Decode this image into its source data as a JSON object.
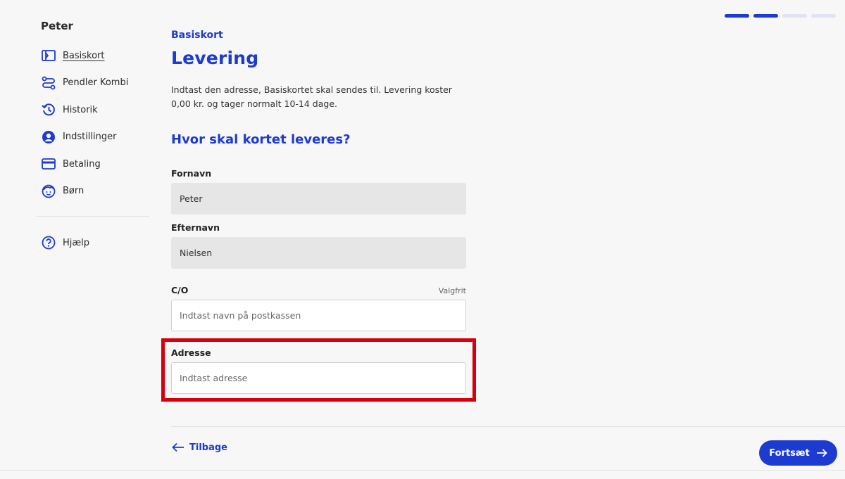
{
  "sidebar": {
    "user_name": "Peter",
    "items": [
      {
        "label": "Basiskort",
        "icon": "card-icon"
      },
      {
        "label": "Pendler Kombi",
        "icon": "route-icon"
      },
      {
        "label": "Historik",
        "icon": "history-icon"
      },
      {
        "label": "Indstillinger",
        "icon": "user-settings-icon"
      },
      {
        "label": "Betaling",
        "icon": "credit-card-icon"
      },
      {
        "label": "Børn",
        "icon": "child-face-icon"
      }
    ],
    "help": {
      "label": "Hjælp",
      "icon": "help-icon"
    }
  },
  "progress": {
    "completed_steps": 2,
    "total_steps": 4
  },
  "main": {
    "eyebrow": "Basiskort",
    "title": "Levering",
    "intro": "Indtast den adresse, Basiskortet skal sendes til. Levering koster 0,00 kr. og tager normalt 10-14 dage.",
    "section_title": "Hvor skal kortet leveres?",
    "fields": {
      "first_name": {
        "label": "Fornavn",
        "value": "Peter"
      },
      "last_name": {
        "label": "Efternavn",
        "value": "Nielsen"
      },
      "co": {
        "label": "C/O",
        "optional": "Valgfrit",
        "placeholder": "Indtast navn på postkassen"
      },
      "address": {
        "label": "Adresse",
        "placeholder": "Indtast adresse"
      }
    }
  },
  "footer": {
    "back_label": "Tilbage",
    "continue_label": "Fortsæt"
  },
  "colors": {
    "accent": "#1d3ad1",
    "highlight": "#d6000d"
  }
}
